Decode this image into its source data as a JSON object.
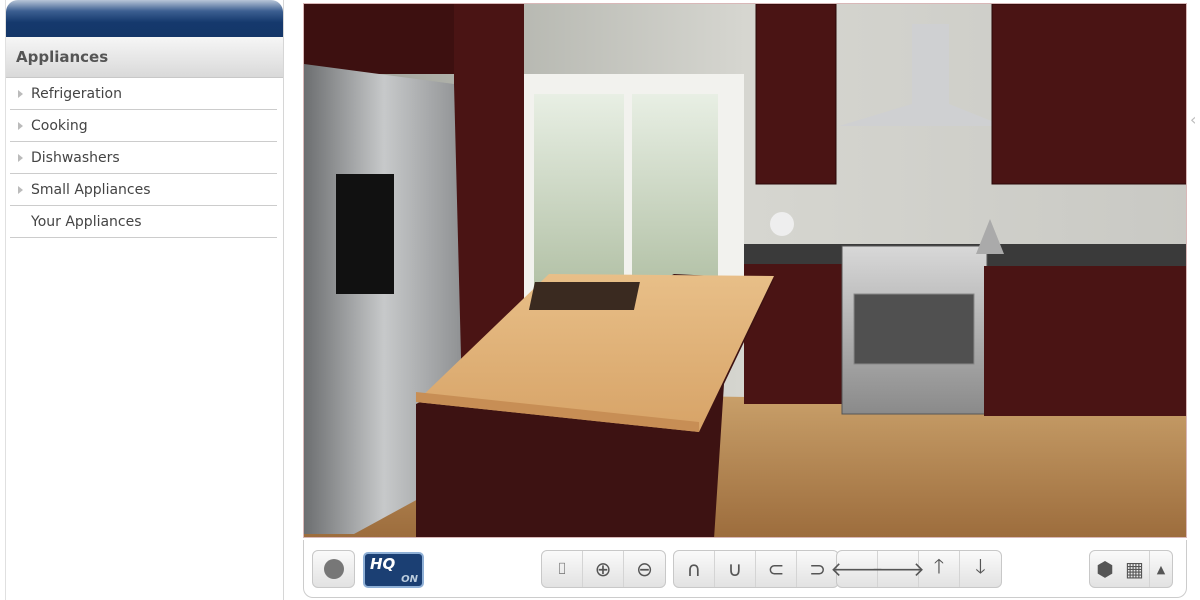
{
  "sidebar": {
    "title": "Appliances",
    "items": [
      {
        "label": "Refrigeration",
        "expandable": true
      },
      {
        "label": "Cooking",
        "expandable": true
      },
      {
        "label": "Dishwashers",
        "expandable": true
      },
      {
        "label": "Small Appliances",
        "expandable": true
      },
      {
        "label": "Your Appliances",
        "expandable": false
      }
    ]
  },
  "toolbar": {
    "hq_label": "HQ",
    "hq_state": "ON",
    "icons": [
      "record-icon",
      "fit-view-icon",
      "zoom-in-icon",
      "zoom-out-icon",
      "tilt-up-icon",
      "tilt-down-icon",
      "rotate-left-icon",
      "rotate-right-icon",
      "arrow-left-icon",
      "arrow-right-icon",
      "arrow-up-icon",
      "arrow-down-icon",
      "3d-view-icon",
      "floor-plan-grid-icon",
      "expand-up-icon"
    ]
  },
  "colors": {
    "header_blue": "#15396d",
    "cabinet": "#4a1414",
    "wood_floor": "#b5834f",
    "countertop": "#e3b47c"
  }
}
